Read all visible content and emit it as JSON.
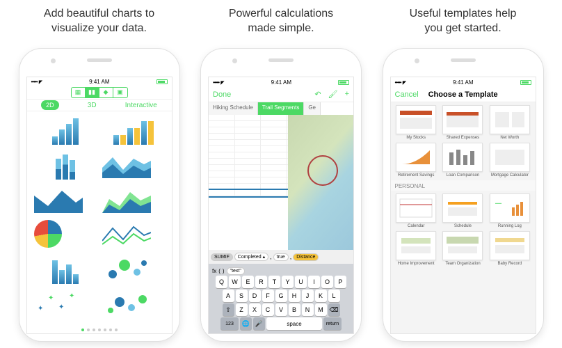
{
  "captions": {
    "c1_l1": "Add beautiful charts to",
    "c1_l2": "visualize your data.",
    "c2_l1": "Powerful calculations",
    "c2_l2": "made simple.",
    "c3_l1": "Useful templates help",
    "c3_l2": "you get started."
  },
  "status": {
    "time": "9:41 AM"
  },
  "s1": {
    "tab2d": "2D",
    "tab3d": "3D",
    "tabint": "Interactive"
  },
  "s2": {
    "done": "Done",
    "undo": "↶",
    "plus": "+",
    "tabs": {
      "a": "Hiking Schedule",
      "b": "Trail Segments",
      "c": "Ge"
    },
    "formula": {
      "fn": "SUMIF",
      "arg1": "Completed",
      "arg2": "true",
      "arg3": "Distance"
    },
    "fx": "fx",
    "quote": "\"text\"",
    "keys": {
      "r1": [
        "Q",
        "W",
        "E",
        "R",
        "T",
        "Y",
        "U",
        "I",
        "O",
        "P"
      ],
      "r2": [
        "A",
        "S",
        "D",
        "F",
        "G",
        "H",
        "J",
        "K",
        "L"
      ],
      "r3": [
        "Z",
        "X",
        "C",
        "V",
        "B",
        "N",
        "M"
      ],
      "shift": "⇧",
      "bksp": "⌫",
      "num": "123",
      "globe": "🌐",
      "mic": "🎤",
      "space": "space",
      "ret": "return"
    }
  },
  "s3": {
    "cancel": "Cancel",
    "title": "Choose a Template",
    "personal": "PERSONAL",
    "tpls": {
      "t1": "My Stocks",
      "t2": "Shared Expenses",
      "t3": "Net Worth",
      "t4": "Retirement Savings",
      "t5": "Loan Comparison",
      "t6": "Mortgage Calculator",
      "t7": "Calendar",
      "t8": "Schedule",
      "t9": "Running Log",
      "t10": "Home Improvement",
      "t11": "Team Organization",
      "t12": "Baby Record"
    }
  }
}
